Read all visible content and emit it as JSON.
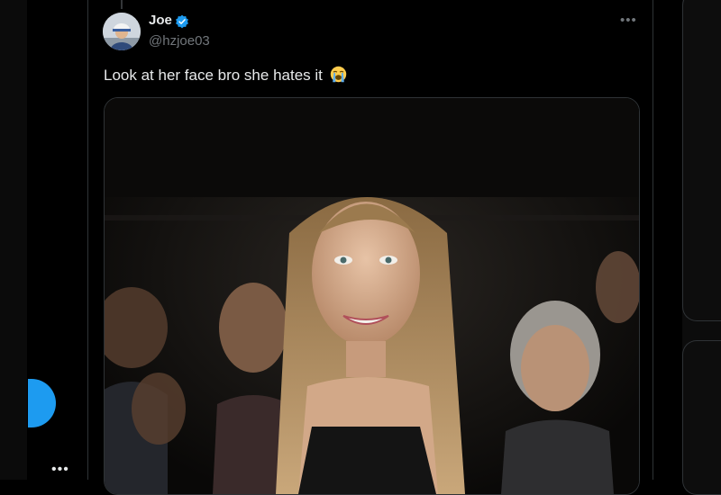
{
  "post": {
    "author_name": "Joe",
    "author_handle": "@hzjoe03",
    "text": "Look at her face bro she hates it",
    "emoji": "loudly-crying-face",
    "verified": true
  },
  "sidebar": {
    "more_label": "•••"
  },
  "post_menu_label": "•••",
  "colors": {
    "accent": "#1d9bf0",
    "background": "#000000",
    "text_primary": "#e7e9ea",
    "text_secondary": "#71767b",
    "border": "#2f3336"
  }
}
